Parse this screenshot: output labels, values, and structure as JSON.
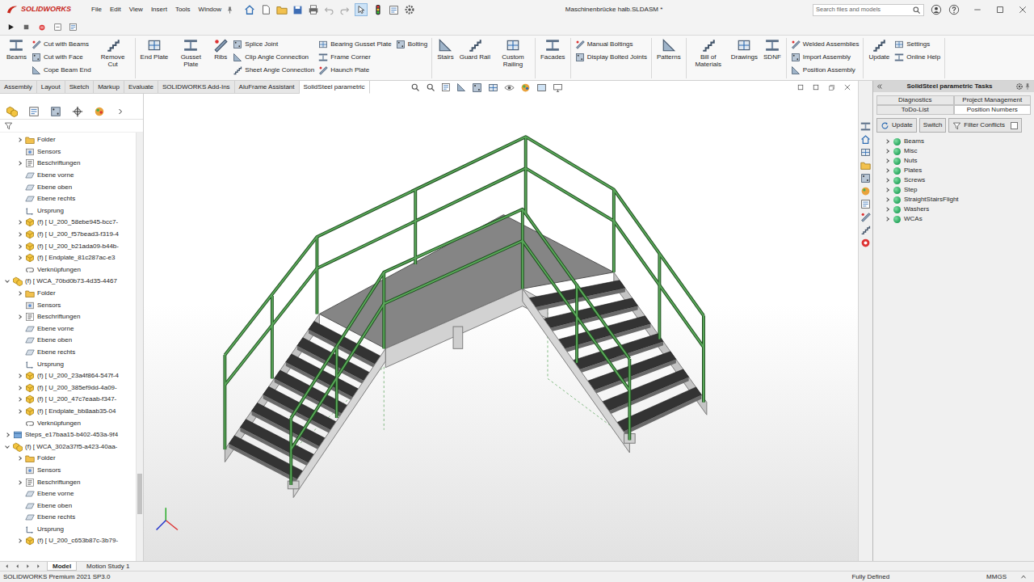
{
  "app": {
    "logo": "SOLIDWORKS",
    "title": "Maschinenbrücke halb.SLDASM *",
    "search_placeholder": "Search files and models"
  },
  "menu": [
    "File",
    "Edit",
    "View",
    "Insert",
    "Tools",
    "Window"
  ],
  "ribbon": [
    {
      "items": [
        {
          "kind": "large",
          "label": "Beams"
        },
        {
          "kind": "stack",
          "labels": [
            "Cut with Beams",
            "Cut with Face",
            "Cope Beam End"
          ]
        },
        {
          "kind": "large",
          "label": "Remove Cut"
        }
      ]
    },
    {
      "items": [
        {
          "kind": "large",
          "label": "End Plate"
        },
        {
          "kind": "large",
          "label": "Gusset Plate"
        },
        {
          "kind": "large",
          "label": "Ribs"
        },
        {
          "kind": "stack",
          "labels": [
            "Splice Joint",
            "Clip Angle Connection",
            "Sheet Angle Connection"
          ]
        },
        {
          "kind": "stack",
          "labels": [
            "Bearing Gusset Plate",
            "Frame Corner",
            "Haunch Plate"
          ]
        },
        {
          "kind": "stack",
          "labels": [
            "Bolting"
          ]
        }
      ]
    },
    {
      "items": [
        {
          "kind": "large",
          "label": "Stairs"
        },
        {
          "kind": "large",
          "label": "Guard Rail"
        },
        {
          "kind": "large",
          "label": "Custom Railing"
        }
      ]
    },
    {
      "items": [
        {
          "kind": "large",
          "label": "Facades"
        }
      ]
    },
    {
      "items": [
        {
          "kind": "stack",
          "labels": [
            "Manual Boltings",
            "Display Bolted Joints"
          ]
        }
      ]
    },
    {
      "items": [
        {
          "kind": "large",
          "label": "Patterns"
        }
      ]
    },
    {
      "items": [
        {
          "kind": "large",
          "label": "Bill of Materials"
        },
        {
          "kind": "large",
          "label": "Drawings"
        },
        {
          "kind": "large",
          "label": "SDNF"
        }
      ]
    },
    {
      "items": [
        {
          "kind": "stack",
          "labels": [
            "Welded Assemblies",
            "Import Assembly",
            "Position Assembly"
          ]
        }
      ]
    },
    {
      "items": [
        {
          "kind": "large",
          "label": "Update"
        },
        {
          "kind": "stack",
          "labels": [
            "Settings",
            "Online Help"
          ]
        }
      ]
    }
  ],
  "command_tabs": [
    {
      "label": "Assembly",
      "selected": false
    },
    {
      "label": "Layout",
      "selected": false
    },
    {
      "label": "Sketch",
      "selected": false
    },
    {
      "label": "Markup",
      "selected": false
    },
    {
      "label": "Evaluate",
      "selected": false
    },
    {
      "label": "SOLIDWORKS Add-Ins",
      "selected": false
    },
    {
      "label": "AluFrame Assistant",
      "selected": false
    },
    {
      "label": "SolidSteel parametric",
      "selected": true
    }
  ],
  "feature_tree": {
    "items": [
      {
        "label": "Folder",
        "depth": 1,
        "kind": "folder",
        "expandable": true,
        "expanded": false
      },
      {
        "label": "Sensors",
        "depth": 1,
        "kind": "sensors",
        "expandable": false,
        "expanded": false
      },
      {
        "label": "Beschriftungen",
        "depth": 1,
        "kind": "annotations",
        "expandable": true,
        "expanded": false
      },
      {
        "label": "Ebene vorne",
        "depth": 1,
        "kind": "plane",
        "expandable": false,
        "expanded": false
      },
      {
        "label": "Ebene oben",
        "depth": 1,
        "kind": "plane",
        "expandable": false,
        "expanded": false
      },
      {
        "label": "Ebene rechts",
        "depth": 1,
        "kind": "plane",
        "expandable": false,
        "expanded": false
      },
      {
        "label": "Ursprung",
        "depth": 1,
        "kind": "origin",
        "expandable": false,
        "expanded": false
      },
      {
        "label": "(f) [ U_200_58ebe945-bcc7-",
        "depth": 1,
        "kind": "part",
        "expandable": true,
        "expanded": false
      },
      {
        "label": "(f) [ U_200_f57bead3-f319-4",
        "depth": 1,
        "kind": "part",
        "expandable": true,
        "expanded": false
      },
      {
        "label": "(f) [ U_200_b21ada09-b44b-",
        "depth": 1,
        "kind": "part",
        "expandable": true,
        "expanded": false
      },
      {
        "label": "(f) [ Endplate_81c287ac-e3",
        "depth": 1,
        "kind": "part",
        "expandable": true,
        "expanded": false
      },
      {
        "label": "Verknüpfungen",
        "depth": 1,
        "kind": "mates",
        "expandable": false,
        "expanded": false
      },
      {
        "label": "(f) [ WCA_70bd0b73-4d35-4467",
        "depth": 0,
        "kind": "subassembly",
        "expandable": true,
        "expanded": true
      },
      {
        "label": "Folder",
        "depth": 1,
        "kind": "folder",
        "expandable": true,
        "expanded": false
      },
      {
        "label": "Sensors",
        "depth": 1,
        "kind": "sensors",
        "expandable": false,
        "expanded": false
      },
      {
        "label": "Beschriftungen",
        "depth": 1,
        "kind": "annotations",
        "expandable": true,
        "expanded": false
      },
      {
        "label": "Ebene vorne",
        "depth": 1,
        "kind": "plane",
        "expandable": false,
        "expanded": false
      },
      {
        "label": "Ebene oben",
        "depth": 1,
        "kind": "plane",
        "expandable": false,
        "expanded": false
      },
      {
        "label": "Ebene rechts",
        "depth": 1,
        "kind": "plane",
        "expandable": false,
        "expanded": false
      },
      {
        "label": "Ursprung",
        "depth": 1,
        "kind": "origin",
        "expandable": false,
        "expanded": false
      },
      {
        "label": "(f) [ U_200_23a4f864-547f-4",
        "depth": 1,
        "kind": "part",
        "expandable": true,
        "expanded": false
      },
      {
        "label": "(f) [ U_200_385ef9dd-4a09-",
        "depth": 1,
        "kind": "part",
        "expandable": true,
        "expanded": false
      },
      {
        "label": "(f) [ U_200_47c7eaab-f347-",
        "depth": 1,
        "kind": "part",
        "expandable": true,
        "expanded": false
      },
      {
        "label": "(f) [ Endplate_bb8aab35-04",
        "depth": 1,
        "kind": "part",
        "expandable": true,
        "expanded": false
      },
      {
        "label": "Verknüpfungen",
        "depth": 1,
        "kind": "mates",
        "expandable": false,
        "expanded": false
      },
      {
        "label": "Steps_e17baa15-b402-453a-9f4",
        "depth": 0,
        "kind": "group",
        "expandable": true,
        "expanded": false
      },
      {
        "label": "(f) [ WCA_302a37f5-a423-40aa-",
        "depth": 0,
        "kind": "subassembly",
        "expandable": true,
        "expanded": true
      },
      {
        "label": "Folder",
        "depth": 1,
        "kind": "folder",
        "expandable": true,
        "expanded": false
      },
      {
        "label": "Sensors",
        "depth": 1,
        "kind": "sensors",
        "expandable": false,
        "expanded": false
      },
      {
        "label": "Beschriftungen",
        "depth": 1,
        "kind": "annotations",
        "expandable": true,
        "expanded": false
      },
      {
        "label": "Ebene vorne",
        "depth": 1,
        "kind": "plane",
        "expandable": false,
        "expanded": false
      },
      {
        "label": "Ebene oben",
        "depth": 1,
        "kind": "plane",
        "expandable": false,
        "expanded": false
      },
      {
        "label": "Ebene rechts",
        "depth": 1,
        "kind": "plane",
        "expandable": false,
        "expanded": false
      },
      {
        "label": "Ursprung",
        "depth": 1,
        "kind": "origin",
        "expandable": false,
        "expanded": false
      },
      {
        "label": "(f) [ U_200_c653b87c-3b79-",
        "depth": 1,
        "kind": "part",
        "expandable": true,
        "expanded": false
      }
    ]
  },
  "task_pane": {
    "title": "SolidSteel parametric Tasks",
    "tabs": [
      {
        "label": "Diagnostics",
        "selected": false
      },
      {
        "label": "Project Management",
        "selected": false
      },
      {
        "label": "ToDo-List",
        "selected": false
      },
      {
        "label": "Position Numbers",
        "selected": true
      }
    ],
    "buttons": [
      "Update",
      "Switch",
      "Filter Conflicts"
    ],
    "filter_conflicts_checked": false,
    "items": [
      {
        "label": "Beams",
        "expanded": false
      },
      {
        "label": "Misc",
        "expanded": false
      },
      {
        "label": "Nuts",
        "expanded": false
      },
      {
        "label": "Plates",
        "expanded": false
      },
      {
        "label": "Screws",
        "expanded": false
      },
      {
        "label": "Step",
        "expanded": false
      },
      {
        "label": "StraightStairsFlight",
        "expanded": false
      },
      {
        "label": "Washers",
        "expanded": false
      },
      {
        "label": "WCAs",
        "expanded": false
      }
    ]
  },
  "bottom_tabs": [
    {
      "label": "Model",
      "selected": true
    },
    {
      "label": "Motion Study 1",
      "selected": false
    }
  ],
  "status_bar": {
    "product": "SOLIDWORKS Premium 2021 SP3.0",
    "state": "Fully Defined",
    "units": "MMGS"
  }
}
